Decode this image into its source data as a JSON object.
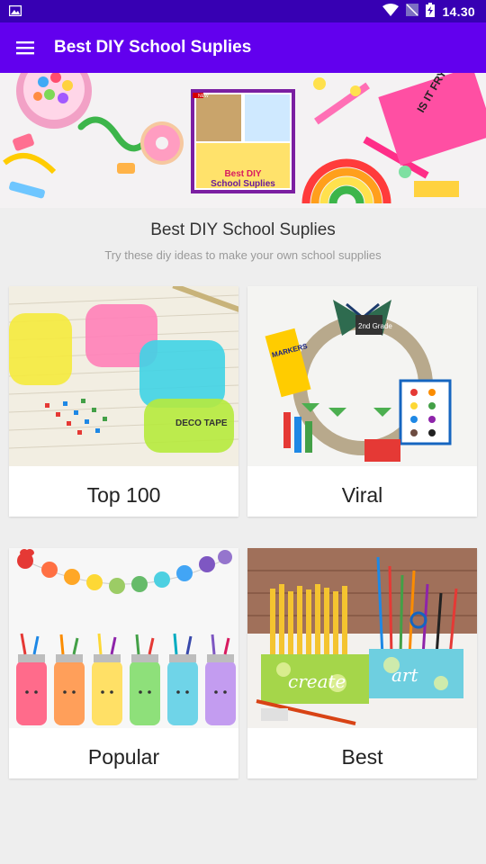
{
  "status_bar": {
    "time": "14.30",
    "icons": [
      "image-notification-icon",
      "wifi-icon",
      "no-sim-icon",
      "battery-charging-icon"
    ]
  },
  "app_bar": {
    "title": "Best DIY School Suplies",
    "menu_icon": "hamburger-menu-icon"
  },
  "banner": {
    "badge": "NEW",
    "logo_line1": "Best DIY",
    "logo_line2": "School Suplies",
    "note_text": "IS IT FRYDAY YET?"
  },
  "header": {
    "title": "Best DIY School Suplies",
    "subtitle": "Try these diy ideas to make your own school supplies"
  },
  "cards": [
    {
      "label": "Top 100",
      "image_text": "DECO TAPE"
    },
    {
      "label": "Viral",
      "image_text": "2nd Grade",
      "image_text2": "MARKERS"
    },
    {
      "label": "Popular"
    },
    {
      "label": "Best",
      "image_text": "create",
      "image_text2": "art"
    }
  ],
  "colors": {
    "status_bar": "#3700b3",
    "app_bar": "#6200ee",
    "background": "#eeeeee"
  }
}
